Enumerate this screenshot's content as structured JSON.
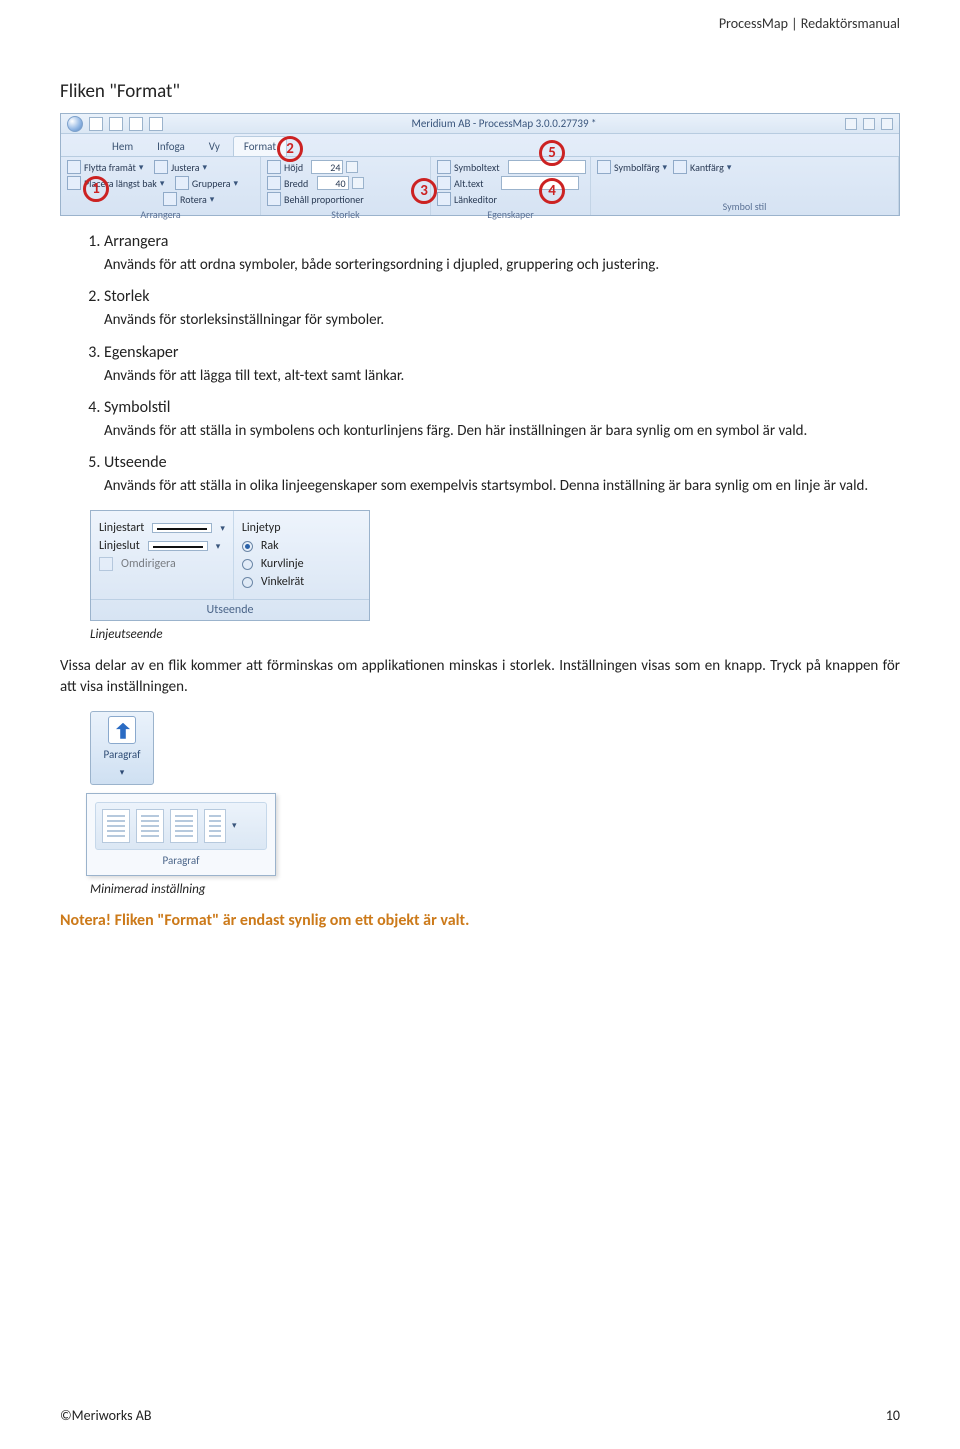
{
  "header": {
    "right": "ProcessMap | Redaktörsmanual"
  },
  "section_title": "Fliken \"Format\"",
  "ribbon": {
    "title_center": "Meridium AB - ProcessMap 3.0.0.27739 *",
    "tabs": [
      "Hem",
      "Infoga",
      "Vy",
      "Format"
    ],
    "active_tab": "Format",
    "arrangera": {
      "caption": "Arrangera",
      "items": [
        "Flytta framåt",
        "Justera",
        "Placera längst bak",
        "Gruppera",
        "Rotera"
      ]
    },
    "storlek": {
      "caption": "Storlek",
      "hojd_label": "Höjd",
      "hojd_value": "24",
      "bredd_label": "Bredd",
      "bredd_value": "40",
      "behall": "Behåll proportioner"
    },
    "egenskaper": {
      "caption": "Egenskaper",
      "items": [
        "Symboltext",
        "Alt.text",
        "Länkeditor"
      ]
    },
    "symbolstil": {
      "caption": "Symbol stil",
      "items": [
        "Symbolfärg",
        "Kantfärg"
      ]
    }
  },
  "callouts": {
    "c1": "1",
    "c2": "2",
    "c3": "3",
    "c4": "4",
    "c5": "5"
  },
  "list": [
    {
      "num": "1.",
      "title": "Arrangera",
      "body": "Används för att ordna symboler, både sorteringsordning i djupled, gruppering och justering."
    },
    {
      "num": "2.",
      "title": "Storlek",
      "body": "Används för storleksinställningar för symboler."
    },
    {
      "num": "3.",
      "title": "Egenskaper",
      "body": "Används för att lägga till text, alt-text samt länkar."
    },
    {
      "num": "4.",
      "title": "Symbolstil",
      "body": "Används för att ställa in symbolens och konturlinjens färg. Den här inställningen är bara synlig om en symbol är vald."
    },
    {
      "num": "5.",
      "title": "Utseende",
      "body": "Används för att ställa in olika linjeegenskaper som exempelvis startsymbol. Denna inställning är bara synlig om en linje är vald."
    }
  ],
  "linjeutseende_panel": {
    "left": {
      "linjestart": "Linjestart",
      "linjeslut": "Linjeslut",
      "omdirigera": "Omdirigera"
    },
    "right": {
      "linjetyp": "Linjetyp",
      "rak": "Rak",
      "kurvlinje": "Kurvlinje",
      "vinkelrat": "Vinkelrät"
    },
    "caption": "Utseende"
  },
  "fig1_caption": "Linjeutseende",
  "para1": "Vissa delar av en flik kommer att förminskas om applikationen minskas i storlek. Inställningen visas som en knapp. Tryck på knappen för att visa inställningen.",
  "paragraf_btn": {
    "label": "Paragraf"
  },
  "popout_caption": "Paragraf",
  "fig2_caption": "Minimerad inställning",
  "note_text": "Notera! Fliken \"Format\" är endast synlig om ett objekt är valt.",
  "footer": {
    "left": "©Meriworks AB",
    "right": "10"
  }
}
